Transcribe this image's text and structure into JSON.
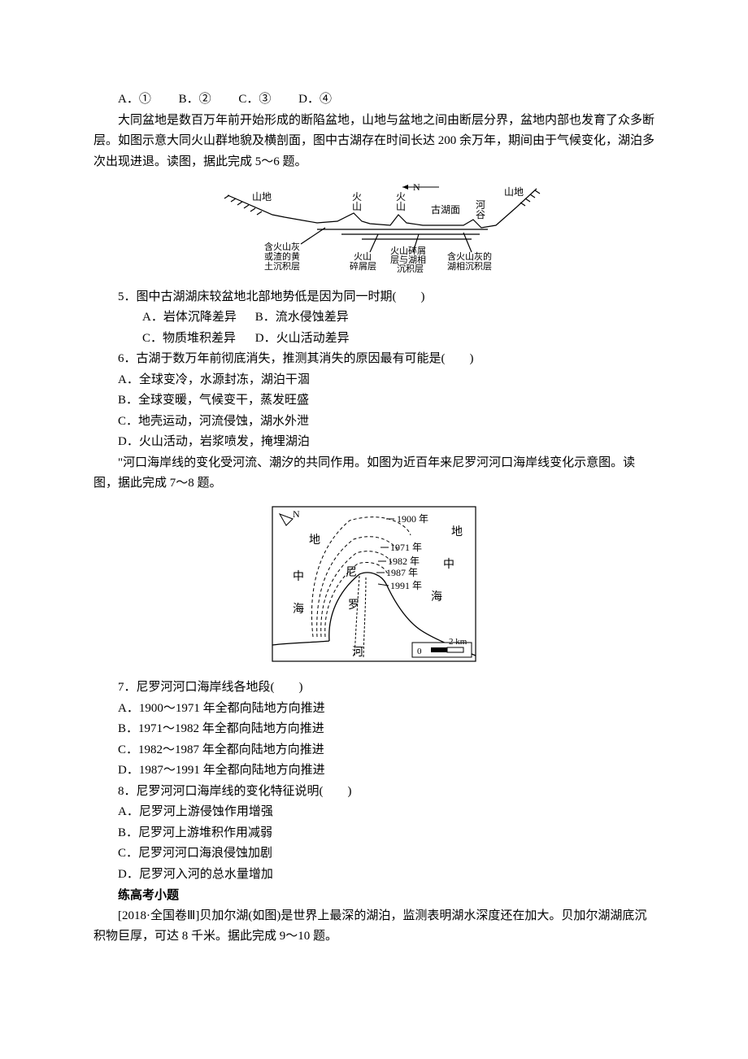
{
  "q_prev_options": {
    "A": "A．①",
    "B": "B．②",
    "C": "C．③",
    "D": "D．④"
  },
  "passage1": {
    "p1": "大同盆地是数百万年前开始形成的断陷盆地，山地与盆地之间由断层分界，盆地内部也发育了众多断层。如图示意大同火山群地貌及横剖面，图中古湖存在时间长达 200 余万年，期间由于气候变化，湖泊多次出现进退。读图，据此完成 5～6 题。"
  },
  "fig1": {
    "labels": {
      "north": "N",
      "mountain_left": "山地",
      "mountain_right": "山地",
      "volcano1": "火山",
      "volcano2": "火山",
      "lakeface": "古湖面",
      "valley": "河谷",
      "loess": "含火山灰或渣的黄土沉积层",
      "debris": "火山碎屑层",
      "debris_lake": "火山碎屑层与湖相沉积层",
      "lake_sediment": "含火山灰的湖相沉积层"
    }
  },
  "q5": {
    "stem": "5．图中古湖湖床较盆地北部地势低是因为同一时期(　　)",
    "A": "A．岩体沉降差异",
    "B": "B．流水侵蚀差异",
    "C": "C．物质堆积差异",
    "D": "D．火山活动差异"
  },
  "q6": {
    "stem": "6．古湖于数万年前彻底消失，推测其消失的原因最有可能是(　　)",
    "A": "A．全球变冷，水源封冻，湖泊干涸",
    "B": "B．全球变暖，气候变干，蒸发旺盛",
    "C": "C．地壳运动，河流侵蚀，湖水外泄",
    "D": "D．火山活动，岩浆喷发，掩埋湖泊"
  },
  "passage2": {
    "p1": "\"河口海岸线的变化受河流、潮汐的共同作用。如图为近百年来尼罗河河口海岸线变化示意图。读图，据此完成 7～8 题。"
  },
  "fig2": {
    "labels": {
      "north": "N",
      "med_left1": "地",
      "med_left2": "中",
      "med_left3": "海",
      "med_right1": "地",
      "med_right2": "中",
      "med_right3": "海",
      "nile_top": "尼",
      "nile_mid": "罗",
      "nile_bot": "河",
      "y1900": "1900 年",
      "y1971": "1971 年",
      "y1982": "1982 年",
      "y1987": "1987 年",
      "y1991": "1991 年",
      "scale0": "0",
      "scale2": "2 km"
    }
  },
  "q7": {
    "stem": "7．尼罗河河口海岸线各地段(　　)",
    "A": "A．1900～1971 年全都向陆地方向推进",
    "B": "B．1971～1982 年全都向陆地方向推进",
    "C": "C．1982～1987 年全都向陆地方向推进",
    "D": "D．1987～1991 年全都向陆地方向推进"
  },
  "q8": {
    "stem": "8．尼罗河河口海岸线的变化特征说明(　　)",
    "A": "A．尼罗河上游侵蚀作用增强",
    "B": "B．尼罗河上游堆积作用减弱",
    "C": "C．尼罗河河口海浪侵蚀加剧",
    "D": "D．尼罗河入河的总水量增加"
  },
  "gaokao_heading": "练高考小题",
  "passage3": {
    "p1": "[2018·全国卷Ⅲ]贝加尔湖(如图)是世界上最深的湖泊，监测表明湖水深度还在加大。贝加尔湖湖底沉积物巨厚，可达 8 千米。据此完成 9～10 题。"
  }
}
